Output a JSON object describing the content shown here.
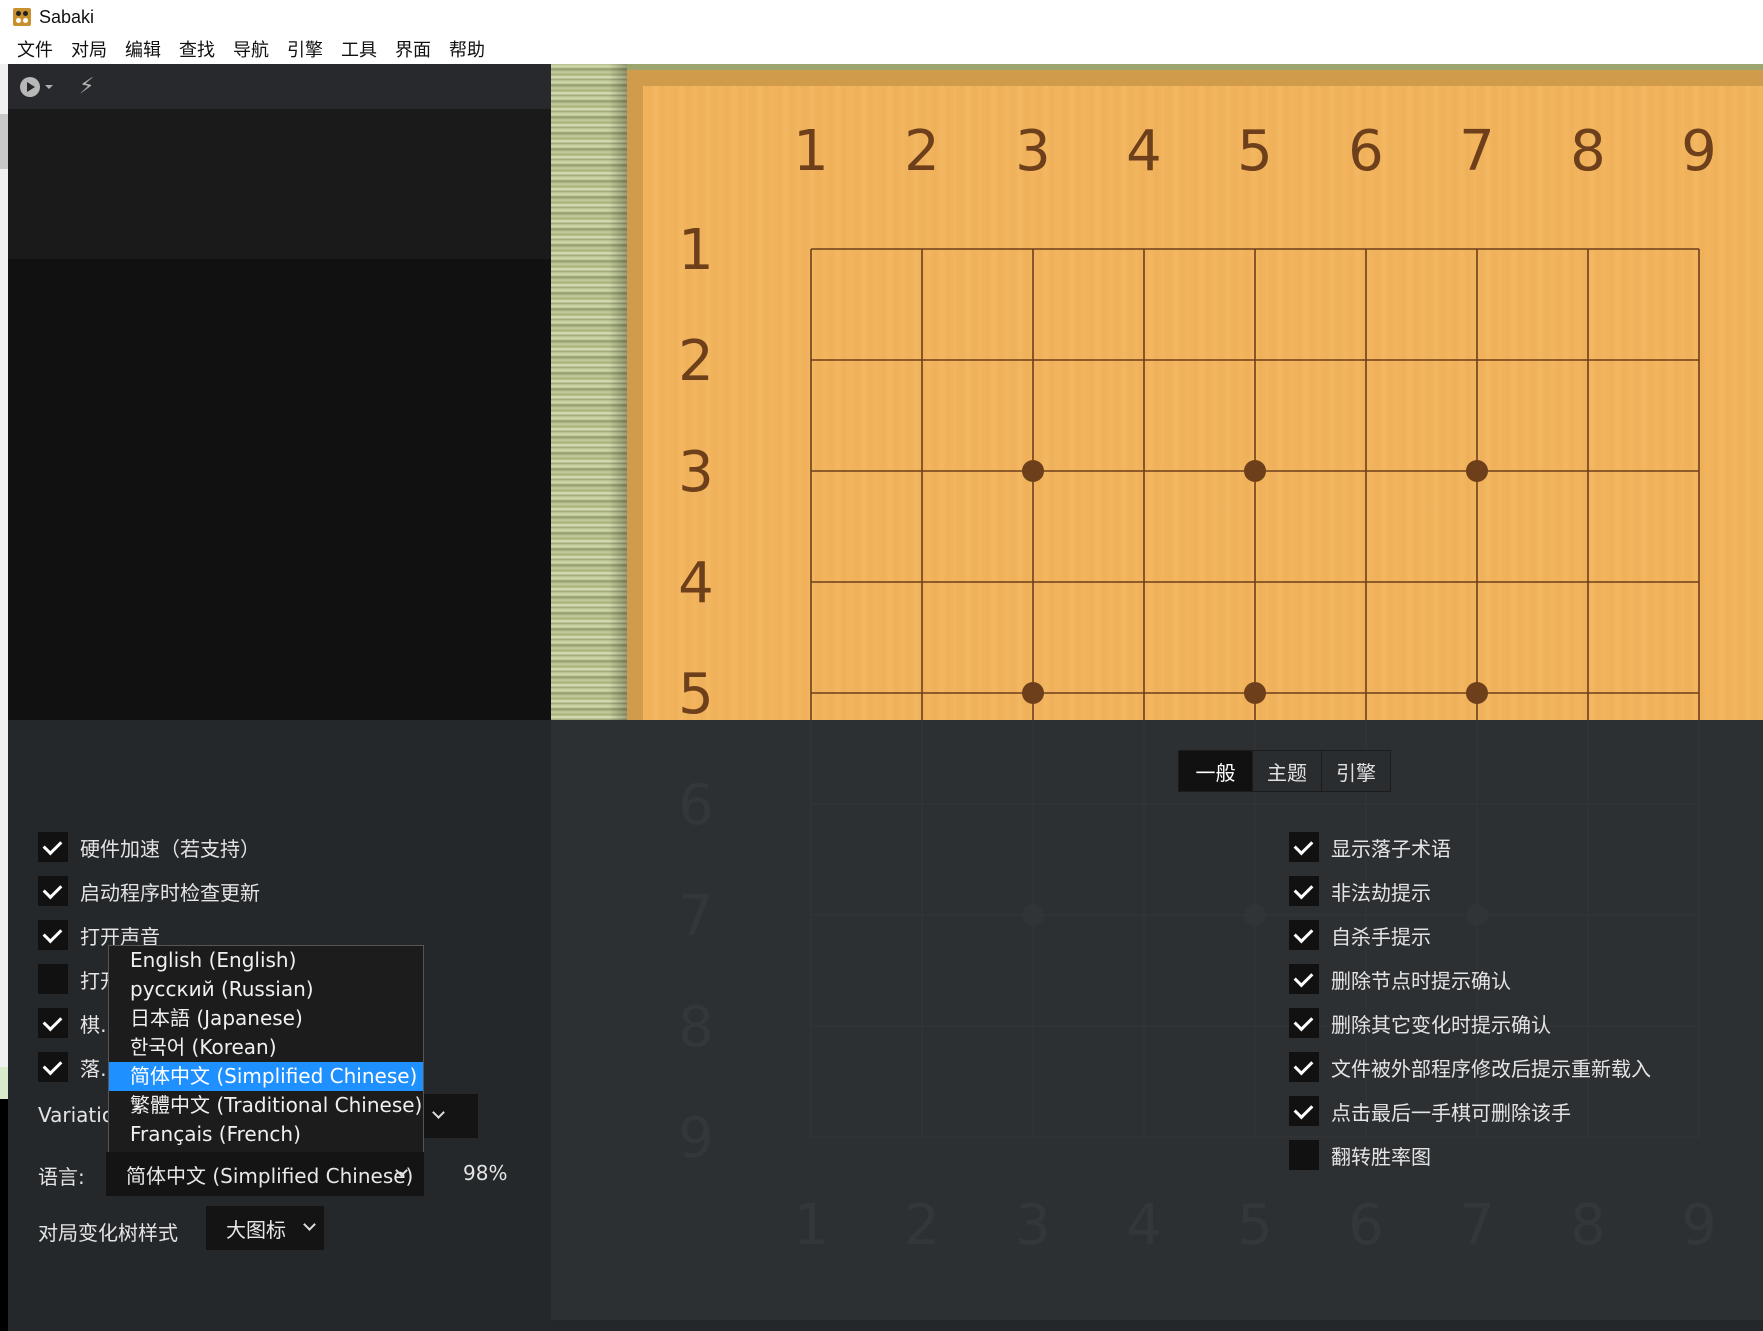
{
  "window": {
    "title": "Sabaki"
  },
  "menu": [
    "文件",
    "对局",
    "编辑",
    "查找",
    "导航",
    "引擎",
    "工具",
    "界面",
    "帮助"
  ],
  "toolbar": {
    "play_icon": "play-circle-icon",
    "caret_icon": "caret-down-icon",
    "bolt_icon": "lightning-icon",
    "bolt_glyph": "⚡"
  },
  "board": {
    "size": 9,
    "visible_rows": 5,
    "col_labels": [
      "1",
      "2",
      "3",
      "4",
      "5",
      "6",
      "7",
      "8",
      "9"
    ],
    "row_labels": [
      "1",
      "2",
      "3",
      "4",
      "5",
      "6",
      "7",
      "8",
      "9"
    ],
    "star_points": [
      [
        3,
        3
      ],
      [
        5,
        3
      ],
      [
        7,
        3
      ],
      [
        3,
        5
      ],
      [
        5,
        5
      ],
      [
        7,
        5
      ],
      [
        3,
        7
      ],
      [
        5,
        7
      ],
      [
        7,
        7
      ]
    ],
    "colors": {
      "wood": "#f2b45d",
      "frame": "#d09b4a",
      "line": "#6d3f1b"
    }
  },
  "preferences": {
    "tabs": [
      {
        "label": "一般",
        "active": true
      },
      {
        "label": "主题",
        "active": false
      },
      {
        "label": "引擎",
        "active": false
      }
    ],
    "left_options": [
      {
        "label": "硬件加速（若支持）",
        "checked": true
      },
      {
        "label": "启动程序时检查更新",
        "checked": true
      },
      {
        "label": "打开声音",
        "checked": true
      },
      {
        "label": "打开…",
        "checked": false
      },
      {
        "label": "棋…线上",
        "checked": true
      },
      {
        "label": "落…",
        "checked": true
      }
    ],
    "variation_label": "Variation",
    "language_label": "语言:",
    "language_value": "简体中文 (Simplified Chinese)",
    "language_completion": "98%",
    "tree_style_label": "对局变化树样式",
    "tree_style_value": "大图标",
    "right_options": [
      {
        "label": "显示落子术语",
        "checked": true
      },
      {
        "label": "非法劫提示",
        "checked": true
      },
      {
        "label": "自杀手提示",
        "checked": true
      },
      {
        "label": "删除节点时提示确认",
        "checked": true
      },
      {
        "label": "删除其它变化时提示确认",
        "checked": true
      },
      {
        "label": "文件被外部程序修改后提示重新载入",
        "checked": true
      },
      {
        "label": "点击最后一手棋可删除该手",
        "checked": true
      },
      {
        "label": "翻转胜率图",
        "checked": false
      }
    ],
    "language_dropdown": {
      "open": true,
      "options": [
        "English (English)",
        "русский (Russian)",
        "日本語 (Japanese)",
        "한국어 (Korean)",
        "简体中文 (Simplified Chinese)",
        "繁體中文 (Traditional Chinese)",
        "Français (French)"
      ],
      "selected_index": 4,
      "highlight_color": "#1e90ff"
    }
  }
}
